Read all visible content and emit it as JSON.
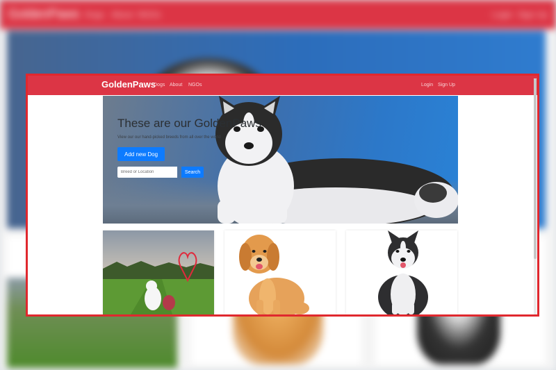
{
  "app": {
    "brand": "GoldenPaws"
  },
  "nav": {
    "links": [
      "Dogs",
      "About",
      "NGOs"
    ],
    "login": "Login",
    "signup": "Sign Up"
  },
  "hero": {
    "title": "These are our GoldenPaws",
    "subtitle": "View our our hand-picked breeds from all over the world",
    "add_button": "Add new Dog",
    "search_placeholder": "Breed or Location",
    "search_button": "Search"
  },
  "cards": [
    {
      "image": "dog-in-field-with-heart"
    },
    {
      "image": "golden-retriever"
    },
    {
      "image": "husky"
    }
  ],
  "colors": {
    "navbar": "#dc3545",
    "primary_button": "#0d7bff",
    "highlight_frame": "#e0282e"
  }
}
